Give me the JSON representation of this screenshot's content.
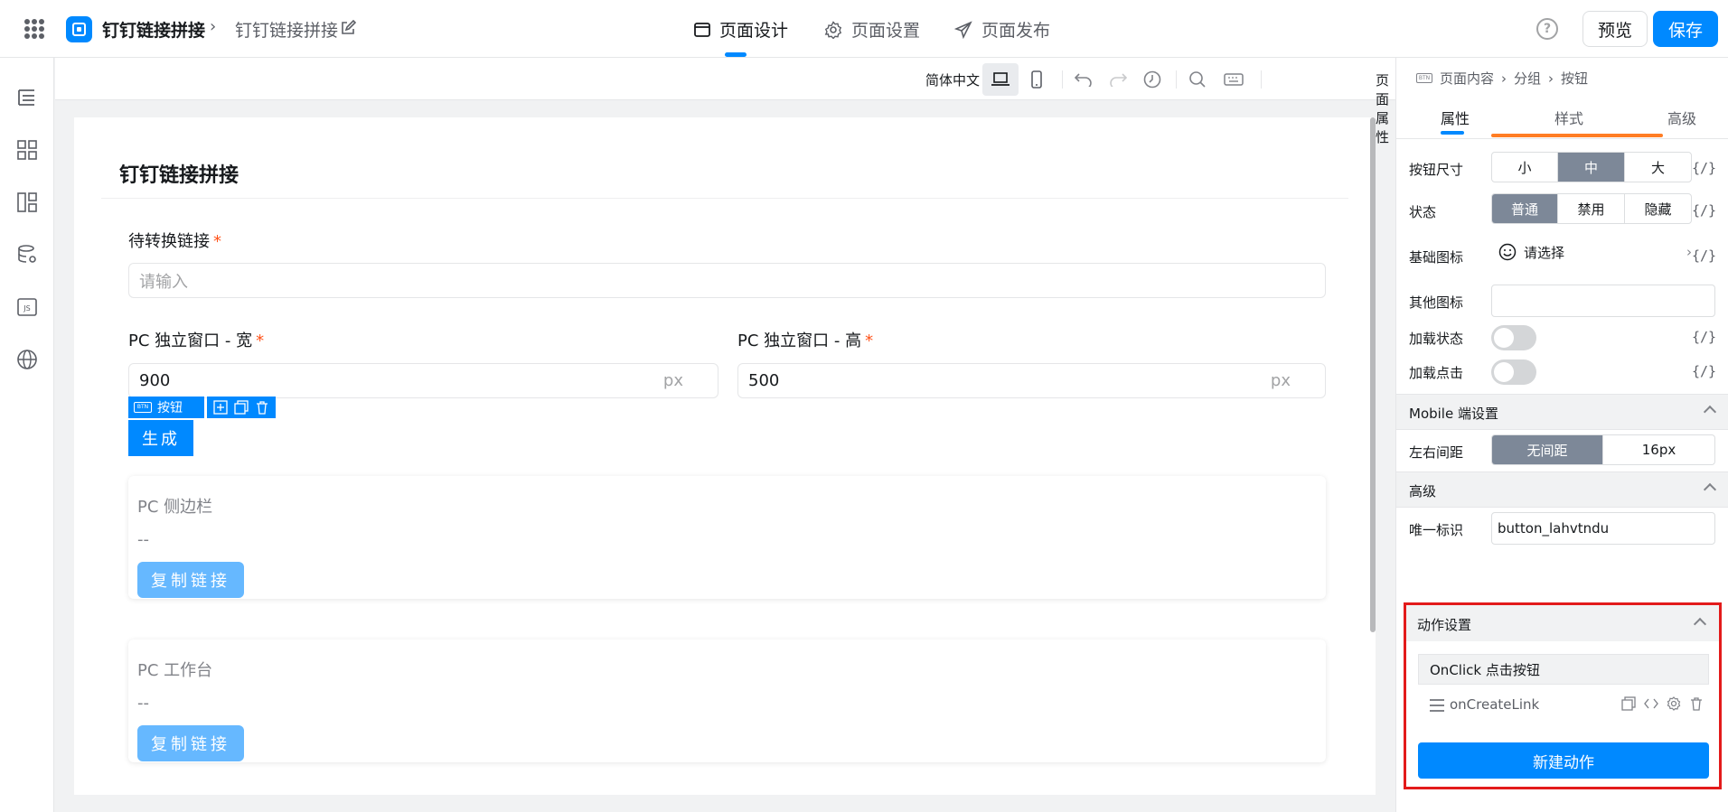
{
  "header": {
    "app_name": "钉钉链接拼接",
    "page_name": "钉钉链接拼接",
    "tabs": [
      {
        "label": "页面设计",
        "active": true
      },
      {
        "label": "页面设置",
        "active": false
      },
      {
        "label": "页面发布",
        "active": false
      }
    ],
    "preview_label": "预览",
    "save_label": "保存",
    "help_glyph": "?"
  },
  "toolbar": {
    "language": "简体中文",
    "page_attr": "页面属性"
  },
  "form": {
    "title": "钉钉链接拼接",
    "field_link": {
      "label": "待转换链接",
      "required": "*",
      "placeholder": "请输入"
    },
    "field_width": {
      "label": "PC 独立窗口 - 宽",
      "required": "*",
      "value": "900",
      "unit": "px"
    },
    "field_height": {
      "label": "PC 独立窗口 - 高",
      "required": "*",
      "value": "500",
      "unit": "px"
    },
    "selected_tag": {
      "icon_text": "BTN",
      "label": "按钮"
    },
    "generate_button": "生成",
    "cards": [
      {
        "title": "PC 侧边栏",
        "value": "--",
        "button": "复制链接"
      },
      {
        "title": "PC 工作台",
        "value": "--",
        "button": "复制链接"
      }
    ]
  },
  "panel": {
    "breadcrumb": {
      "icon_text": "BTN",
      "items": [
        "页面内容",
        "分组",
        "按钮"
      ]
    },
    "tabs": [
      {
        "label": "属性",
        "active": true
      },
      {
        "label": "样式",
        "active": false
      },
      {
        "label": "高级",
        "active": false
      }
    ],
    "fx_label": "{/}",
    "button_size": {
      "label": "按钮尺寸",
      "options": [
        "小",
        "中",
        "大"
      ],
      "selected": "中"
    },
    "state": {
      "label": "状态",
      "options": [
        "普通",
        "禁用",
        "隐藏"
      ],
      "selected": "普通"
    },
    "base_icon": {
      "label": "基础图标",
      "value": "请选择"
    },
    "other_icon": {
      "label": "其他图标",
      "value": ""
    },
    "loading_state": {
      "label": "加载状态",
      "on": false
    },
    "loading_click": {
      "label": "加载点击",
      "on": false
    },
    "mobile_section": {
      "title": "Mobile 端设置"
    },
    "lr_spacing": {
      "label": "左右间距",
      "options": [
        "无间距",
        "16px"
      ],
      "selected": "无间距"
    },
    "advanced_section": {
      "title": "高级"
    },
    "unique_id": {
      "label": "唯一标识",
      "value": "button_lahvtndu"
    },
    "action_section": {
      "title": "动作设置",
      "event": "OnClick 点击按钮",
      "actions": [
        {
          "name": "onCreateLink"
        }
      ],
      "new_action": "新建动作"
    }
  },
  "colors": {
    "primary": "#0089ff",
    "segment_active": "#7d8898",
    "required": "#ff5219",
    "highlight_box": "#e31b1b",
    "copy_button": "#66b8ff"
  }
}
